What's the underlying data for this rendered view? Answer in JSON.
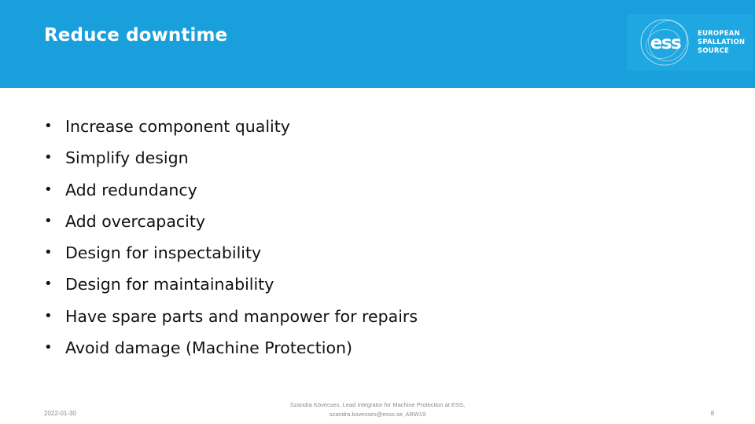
{
  "slide": {
    "title": "Reduce downtime",
    "bullets": [
      "Increase component quality",
      "Simplify design",
      "Add redundancy",
      "Add overcapacity",
      "Design for inspectability",
      "Design for maintainability",
      "Have spare parts and manpower for repairs",
      "Avoid damage (Machine Protection)"
    ],
    "bullet_glyph": "•"
  },
  "logo": {
    "mark_text": "ess",
    "lines": [
      "EUROPEAN",
      "SPALLATION",
      "SOURCE"
    ],
    "icon": "ess-logo-icon"
  },
  "footer": {
    "date": "2022-01-30",
    "author_line1": "Szandra Kövecses, Lead Integrator for Machine Protection at ESS,",
    "author_line2": "szandra.kovecses@esss.se, ARW19",
    "page_number": "8"
  },
  "colors": {
    "header_bg": "#199fdb",
    "logo_bg": "#1ea7e1",
    "text": "#111111",
    "footer_text": "#8a8a8a"
  }
}
